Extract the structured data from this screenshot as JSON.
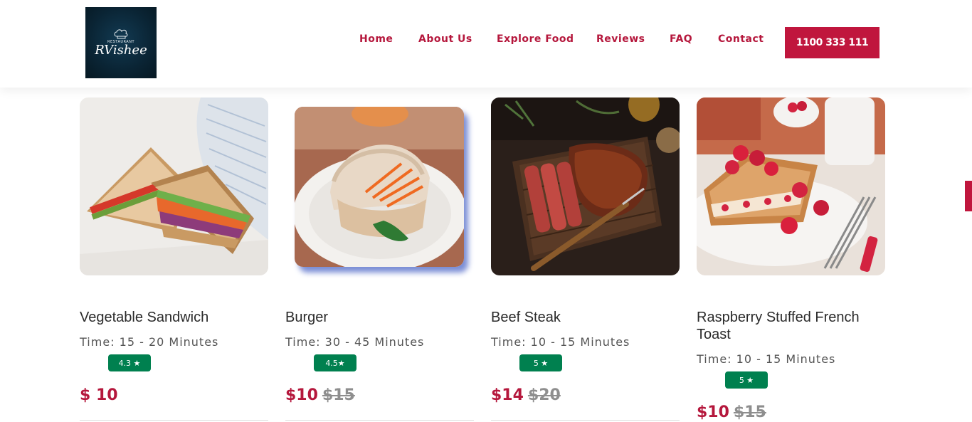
{
  "brand": {
    "tagline": "RESTAURANT",
    "name": "RVishee"
  },
  "nav": {
    "items": [
      "Home",
      "About Us",
      "Explore Food",
      "Reviews",
      "FAQ",
      "Contact"
    ],
    "phone": "1100 333 111"
  },
  "colors": {
    "accent": "#c0163d",
    "rating_badge": "#00804f",
    "strike_price": "#8e8e8e"
  },
  "foods": [
    {
      "name": "Vegetable Sandwich",
      "time": "Time: 15 - 20 Minutes",
      "rating": "4.3 ★",
      "price": "$ 10",
      "old_price": ""
    },
    {
      "name": "Burger",
      "time": "Time: 30 - 45 Minutes",
      "rating": "4.5★",
      "price": "$10",
      "old_price": "$15"
    },
    {
      "name": "Beef Steak",
      "time": "Time: 10 - 15 Minutes",
      "rating": "5 ★",
      "price": "$14",
      "old_price": "$20"
    },
    {
      "name": "Raspberry Stuffed French Toast",
      "time": "Time: 10 - 15 Minutes",
      "rating": "5 ★",
      "price": "$10",
      "old_price": "$15"
    }
  ]
}
